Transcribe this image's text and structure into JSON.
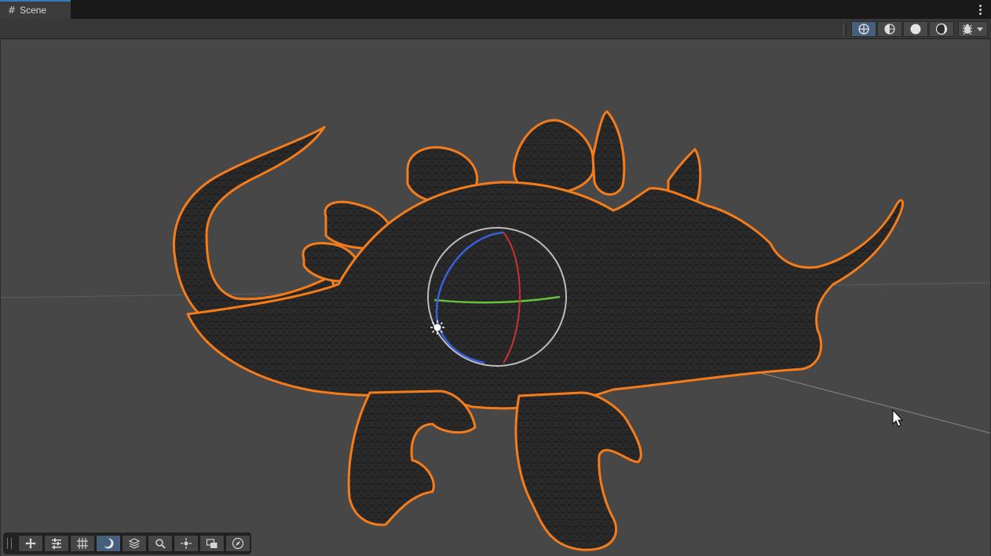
{
  "window": {
    "tab_label": "Scene",
    "tab_icon": "grid-hash-icon",
    "menu_icon": "kebab-menu-icon"
  },
  "toolbar": {
    "shading_modes": [
      {
        "name": "wireframe-mode",
        "icon": "wireframe-globe-icon",
        "active": true
      },
      {
        "name": "shaded-wireframe-mode",
        "icon": "shaded-wireframe-icon",
        "active": false
      },
      {
        "name": "unlit-mode",
        "icon": "unlit-sphere-icon",
        "active": false
      },
      {
        "name": "lit-mode",
        "icon": "lit-sphere-icon",
        "active": false
      }
    ],
    "effects_icon": "bug-effects-icon",
    "effects_dropdown_icon": "chevron-down-icon"
  },
  "viewport": {
    "object": "dinosaur-mesh",
    "selection_outline_color": "#f57c1a",
    "mesh_color": "#2a2a2a",
    "background_color": "#474747",
    "light_gizmo": {
      "x_axis_color": "#d03030",
      "y_axis_color": "#63c23a",
      "z_axis_color": "#3a5fe0"
    }
  },
  "overlay_toolbar": {
    "buttons": [
      {
        "name": "move-tool",
        "icon": "move-arrows-icon",
        "active": false
      },
      {
        "name": "tool-settings",
        "icon": "sliders-icon",
        "active": false
      },
      {
        "name": "grid-snapping",
        "icon": "grid-snap-icon",
        "active": false
      },
      {
        "name": "draw-mode",
        "icon": "moon-shading-icon",
        "active": true
      },
      {
        "name": "layers",
        "icon": "layers-icon",
        "active": false
      },
      {
        "name": "search",
        "icon": "search-icon",
        "active": false
      },
      {
        "name": "pivot",
        "icon": "pivot-icon",
        "active": false
      },
      {
        "name": "camera-view",
        "icon": "camera-view-icon",
        "active": false
      },
      {
        "name": "orientation",
        "icon": "compass-icon",
        "active": false
      }
    ]
  },
  "accent_color": "#46607c"
}
